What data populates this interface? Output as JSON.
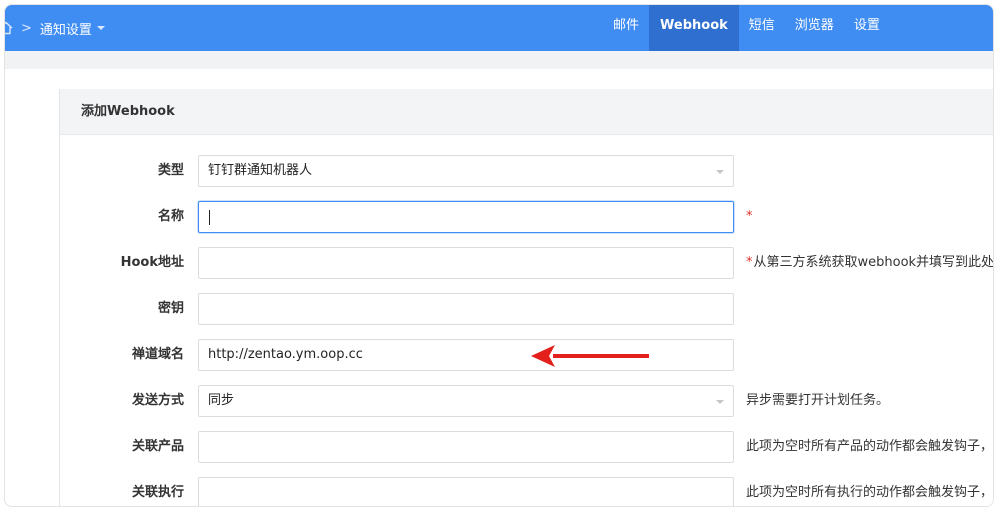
{
  "topbar": {
    "breadcrumb_sep": ">",
    "title": "通知设置",
    "nav": [
      {
        "label": "邮件",
        "active": false
      },
      {
        "label": "Webhook",
        "active": true
      },
      {
        "label": "短信",
        "active": false
      },
      {
        "label": "浏览器",
        "active": false
      },
      {
        "label": "设置",
        "active": false
      }
    ],
    "color": "#3f8cf2",
    "active_color": "#2f6fd0"
  },
  "panel": {
    "title": "添加Webhook"
  },
  "form": {
    "type": {
      "label": "类型",
      "value": "钉钉群通知机器人"
    },
    "name": {
      "label": "名称",
      "value": "",
      "required": "*"
    },
    "hook": {
      "label": "Hook地址",
      "value": "",
      "required": "*",
      "hint": "从第三方系统获取webhook并填写到此处。"
    },
    "secret": {
      "label": "密钥",
      "value": ""
    },
    "domain": {
      "label": "禅道域名",
      "value": "http://zentao.ym.oop.cc"
    },
    "send": {
      "label": "发送方式",
      "value": "同步",
      "hint": "异步需要打开计划任务。"
    },
    "products": {
      "label": "关联产品",
      "value": "",
      "hint": "此项为空时所有产品的动作都会触发钩子，"
    },
    "executions": {
      "label": "关联执行",
      "value": "",
      "hint": "此项为空时所有执行的动作都会触发钩子，"
    }
  },
  "annotation": {
    "arrow_color": "#e3201b"
  }
}
